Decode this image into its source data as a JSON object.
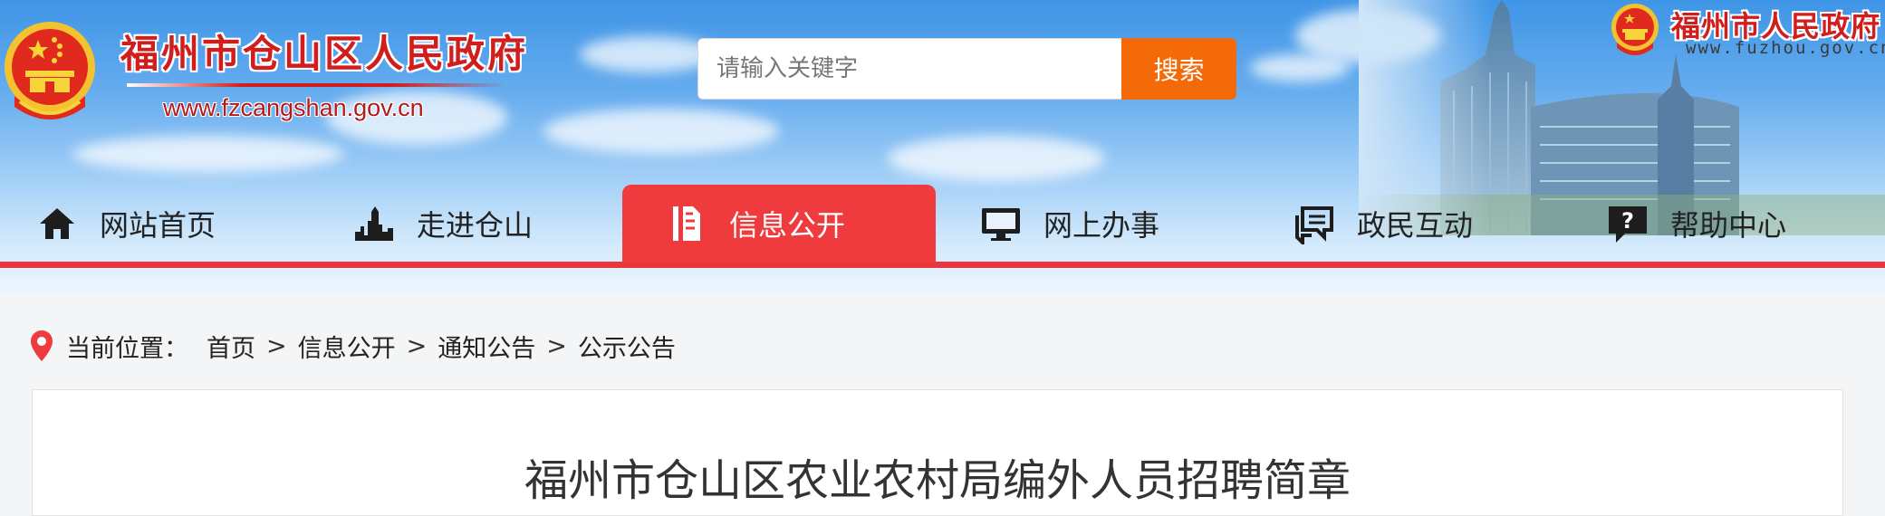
{
  "header": {
    "site_name": "福州市仓山区人民政府",
    "site_url": "www.fzcangshan.gov.cn",
    "city_name": "福州市人民政府",
    "city_url": "www.fuzhou.gov.cn"
  },
  "search": {
    "placeholder": "请输入关键字",
    "button_label": "搜索"
  },
  "nav": {
    "items": [
      {
        "label": "网站首页",
        "icon": "home-icon"
      },
      {
        "label": "走进仓山",
        "icon": "city-skyline-icon"
      },
      {
        "label": "信息公开",
        "icon": "document-icon",
        "active": true
      },
      {
        "label": "网上办事",
        "icon": "monitor-icon"
      },
      {
        "label": "政民互动",
        "icon": "chat-icon"
      },
      {
        "label": "帮助中心",
        "icon": "help-icon"
      }
    ]
  },
  "breadcrumb": {
    "prefix": "当前位置：",
    "items": [
      "首页",
      "信息公开",
      "通知公告",
      "公示公告"
    ],
    "separator": ">"
  },
  "article": {
    "title": "福州市仓山区农业农村局编外人员招聘简章"
  },
  "colors": {
    "accent_red": "#ef3b3e",
    "search_orange": "#f46a08",
    "title_red": "#d21d1d"
  }
}
